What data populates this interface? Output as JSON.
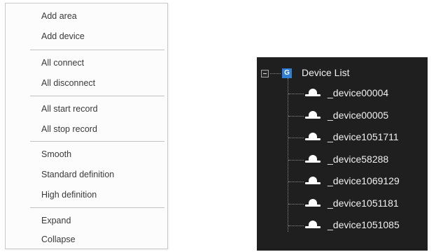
{
  "context_menu": {
    "groups": [
      [
        "Add area",
        "Add device"
      ],
      [
        "All connect",
        "All disconnect"
      ],
      [
        "All start record",
        "All stop record"
      ],
      [
        "Smooth",
        "Standard definition",
        "High definition"
      ],
      [
        "Expand",
        "Collapse"
      ]
    ]
  },
  "device_tree": {
    "root_icon_letter": "G",
    "root_label": "Device List",
    "devices": [
      "_device00004",
      "_device00005",
      "_device1051711",
      "_device58288",
      "_device1069129",
      "_device1051181",
      "_device1051085"
    ]
  },
  "colors": {
    "tree_background": "#1f1f1f",
    "root_icon": "#2f7fd6",
    "menu_separator": "#c2c2c2"
  }
}
